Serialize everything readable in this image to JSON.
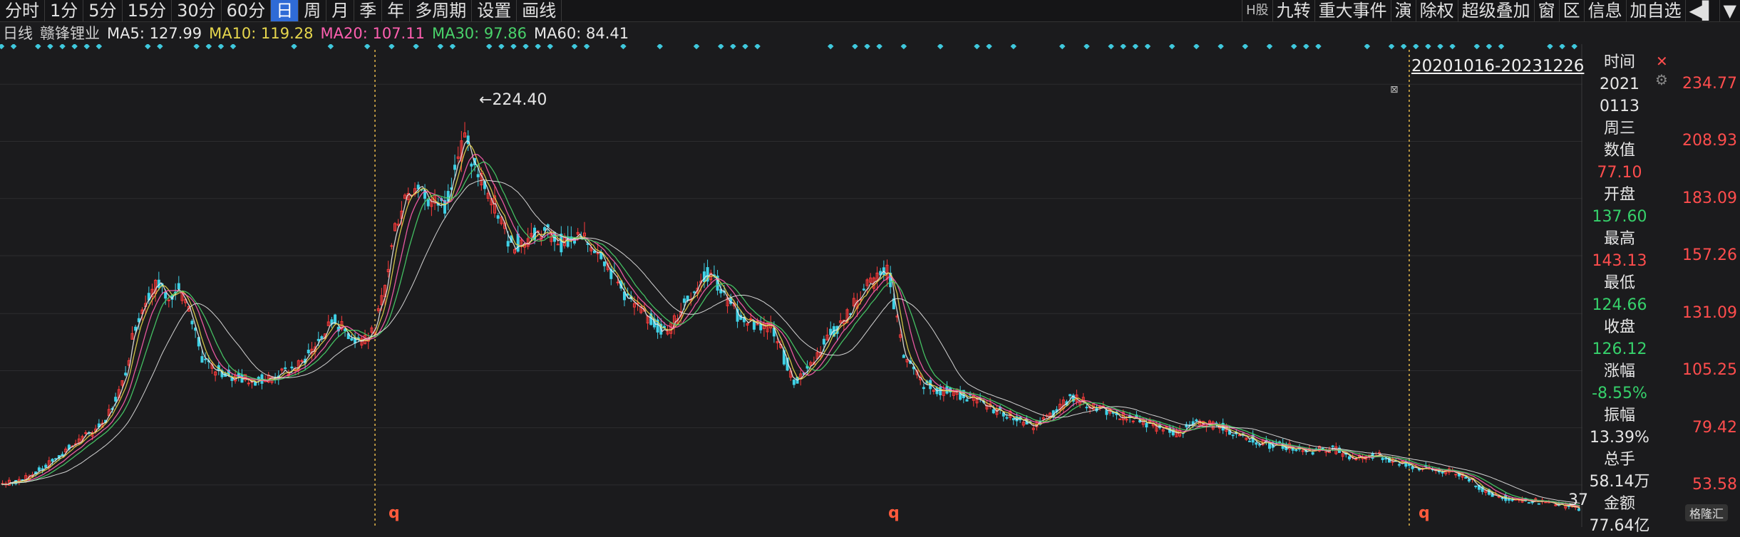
{
  "toolbar": {
    "periods": [
      "分时",
      "1分",
      "5分",
      "15分",
      "30分",
      "60分",
      "日",
      "周",
      "月",
      "季",
      "年",
      "多周期",
      "设置",
      "画线"
    ],
    "active_index": 6,
    "tools": [
      "H股",
      "九转",
      "重大事件",
      "演",
      "除权",
      "超级叠加",
      "窗",
      "区",
      "信息",
      "加自选",
      "◀▌",
      "▼"
    ]
  },
  "legend": {
    "period": "日线",
    "name": "赣锋锂业",
    "ma5": "MA5: 127.99",
    "ma10": "MA10: 119.28",
    "ma20": "MA20: 107.11",
    "ma30": "MA30: 97.86",
    "ma60": "MA60: 84.41"
  },
  "colors": {
    "bg": "#1b1b1d",
    "up": "#ff3b3b",
    "down": "#3fd1e6",
    "ma5": "#e8e8e8",
    "ma10": "#e6d64d",
    "ma20": "#ff5fb0",
    "ma30": "#49d26a",
    "ma60": "#e8e8e8",
    "vline": "#e6b84a"
  },
  "side": {
    "range": "20201016-20231226",
    "labels": [
      {
        "t": "时间",
        "c": "lbl"
      },
      {
        "t": "2021",
        "c": "white"
      },
      {
        "t": "0113",
        "c": "white"
      },
      {
        "t": "周三",
        "c": "white"
      },
      {
        "t": "数值",
        "c": "lbl"
      },
      {
        "t": "77.10",
        "c": "red"
      },
      {
        "t": "开盘",
        "c": "lbl"
      },
      {
        "t": "137.60",
        "c": "green"
      },
      {
        "t": "最高",
        "c": "lbl"
      },
      {
        "t": "143.13",
        "c": "red"
      },
      {
        "t": "最低",
        "c": "lbl"
      },
      {
        "t": "124.66",
        "c": "green"
      },
      {
        "t": "收盘",
        "c": "lbl"
      },
      {
        "t": "126.12",
        "c": "green"
      },
      {
        "t": "涨幅",
        "c": "lbl"
      },
      {
        "t": "-8.55%",
        "c": "green"
      },
      {
        "t": "振幅",
        "c": "lbl"
      },
      {
        "t": "13.39%",
        "c": "white"
      },
      {
        "t": "总手",
        "c": "lbl"
      },
      {
        "t": "58.14万",
        "c": "white"
      },
      {
        "t": "金额",
        "c": "lbl"
      },
      {
        "t": "77.64亿",
        "c": "white"
      }
    ]
  },
  "annotations": {
    "peak": "224.40",
    "qmark": "q",
    "tail": "37",
    "logo": "格隆汇"
  },
  "chart_data": {
    "type": "candlestick",
    "title": "赣锋锂业",
    "y_axis_ticks": [
      "234.77",
      "208.93",
      "183.09",
      "157.26",
      "131.09",
      "105.25",
      "79.42",
      "53.58"
    ],
    "ylim": [
      41,
      240
    ],
    "peak_value": 224.4,
    "close_path": [
      [
        0,
        54
      ],
      [
        20,
        56
      ],
      [
        40,
        62
      ],
      [
        60,
        70
      ],
      [
        80,
        77
      ],
      [
        95,
        84
      ],
      [
        110,
        100
      ],
      [
        120,
        125
      ],
      [
        130,
        138
      ],
      [
        140,
        145
      ],
      [
        150,
        140
      ],
      [
        160,
        142
      ],
      [
        170,
        130
      ],
      [
        180,
        112
      ],
      [
        190,
        106
      ],
      [
        200,
        104
      ],
      [
        210,
        102
      ],
      [
        230,
        101
      ],
      [
        250,
        103
      ],
      [
        270,
        108
      ],
      [
        285,
        118
      ],
      [
        300,
        128
      ],
      [
        310,
        123
      ],
      [
        320,
        119
      ],
      [
        335,
        122
      ],
      [
        345,
        140
      ],
      [
        355,
        170
      ],
      [
        365,
        186
      ],
      [
        375,
        190
      ],
      [
        385,
        182
      ],
      [
        400,
        180
      ],
      [
        410,
        200
      ],
      [
        418,
        210
      ],
      [
        425,
        198
      ],
      [
        435,
        190
      ],
      [
        445,
        180
      ],
      [
        460,
        162
      ],
      [
        475,
        165
      ],
      [
        490,
        168
      ],
      [
        505,
        163
      ],
      [
        520,
        165
      ],
      [
        540,
        160
      ],
      [
        555,
        145
      ],
      [
        570,
        135
      ],
      [
        585,
        128
      ],
      [
        600,
        122
      ],
      [
        615,
        135
      ],
      [
        630,
        146
      ],
      [
        640,
        150
      ],
      [
        650,
        140
      ],
      [
        665,
        130
      ],
      [
        680,
        126
      ],
      [
        695,
        125
      ],
      [
        705,
        112
      ],
      [
        715,
        100
      ],
      [
        730,
        108
      ],
      [
        745,
        120
      ],
      [
        760,
        128
      ],
      [
        775,
        140
      ],
      [
        790,
        148
      ],
      [
        800,
        150
      ],
      [
        805,
        135
      ],
      [
        815,
        110
      ],
      [
        830,
        100
      ],
      [
        850,
        96
      ],
      [
        870,
        94
      ],
      [
        890,
        89
      ],
      [
        910,
        85
      ],
      [
        930,
        80
      ],
      [
        950,
        86
      ],
      [
        965,
        94
      ],
      [
        980,
        90
      ],
      [
        1000,
        86
      ],
      [
        1020,
        84
      ],
      [
        1040,
        80
      ],
      [
        1060,
        77
      ],
      [
        1080,
        82
      ],
      [
        1100,
        80
      ],
      [
        1120,
        76
      ],
      [
        1140,
        72
      ],
      [
        1160,
        71
      ],
      [
        1180,
        69
      ],
      [
        1200,
        70
      ],
      [
        1220,
        66
      ],
      [
        1240,
        67
      ],
      [
        1260,
        64
      ],
      [
        1280,
        61
      ],
      [
        1300,
        60
      ],
      [
        1320,
        58
      ],
      [
        1335,
        52
      ],
      [
        1350,
        48
      ],
      [
        1370,
        47
      ],
      [
        1390,
        46
      ],
      [
        1410,
        44
      ],
      [
        1425,
        43
      ]
    ],
    "q_markers_index": [
      352,
      805,
      1283
    ],
    "vertical_lines_index": [
      337,
      1270
    ],
    "dots_row": true,
    "n_bars": 1425
  }
}
